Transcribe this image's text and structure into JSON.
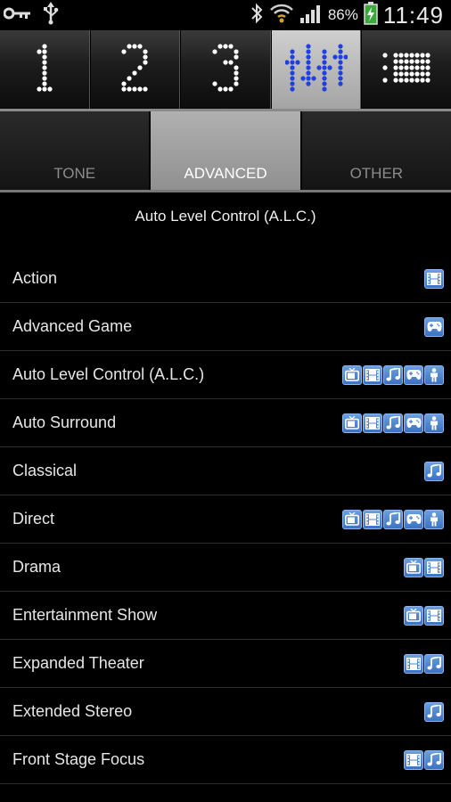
{
  "status": {
    "battery_pct": "86%",
    "time": "11:49"
  },
  "top_tabs": [
    {
      "id": "1",
      "icon": "dot-matrix-1-icon"
    },
    {
      "id": "2",
      "icon": "dot-matrix-2-icon"
    },
    {
      "id": "3",
      "icon": "dot-matrix-3-icon"
    },
    {
      "id": "eq",
      "icon": "equalizer-sliders-icon",
      "active": true
    },
    {
      "id": "list",
      "icon": "list-menu-icon"
    }
  ],
  "sub_tabs": [
    {
      "label": "TONE"
    },
    {
      "label": "ADVANCED",
      "active": true
    },
    {
      "label": "OTHER"
    }
  ],
  "header_title": "Auto Level Control (A.L.C.)",
  "modes": [
    {
      "label": "Action",
      "icons": [
        "movie"
      ]
    },
    {
      "label": "Advanced Game",
      "icons": [
        "game"
      ]
    },
    {
      "label": "Auto Level Control (A.L.C.)",
      "icons": [
        "tv",
        "movie",
        "music",
        "game",
        "person"
      ]
    },
    {
      "label": "Auto Surround",
      "icons": [
        "tv",
        "movie",
        "music",
        "game",
        "person"
      ]
    },
    {
      "label": "Classical",
      "icons": [
        "music"
      ]
    },
    {
      "label": "Direct",
      "icons": [
        "tv",
        "movie",
        "music",
        "game",
        "person"
      ]
    },
    {
      "label": "Drama",
      "icons": [
        "tv",
        "movie"
      ]
    },
    {
      "label": "Entertainment Show",
      "icons": [
        "tv",
        "movie"
      ]
    },
    {
      "label": "Expanded Theater",
      "icons": [
        "movie",
        "music"
      ]
    },
    {
      "label": "Extended Stereo",
      "icons": [
        "music"
      ]
    },
    {
      "label": "Front Stage Focus",
      "icons": [
        "movie",
        "music"
      ]
    }
  ],
  "colors": {
    "accent_blue": "#1f3fe0",
    "icon_blue": "#4f86d6"
  }
}
